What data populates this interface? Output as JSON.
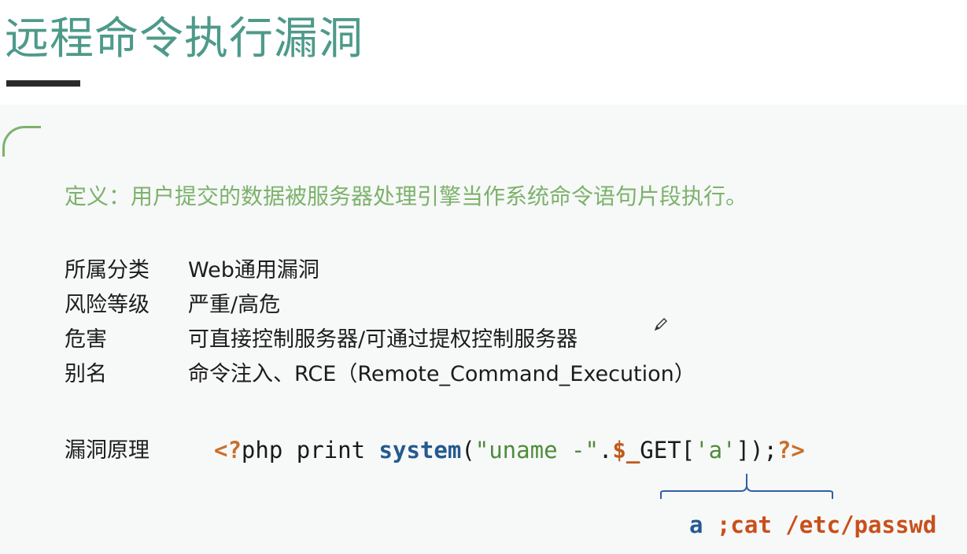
{
  "slide": {
    "title": "远程命令执行漏洞",
    "definition": "定义：用户提交的数据被服务器处理引擎当作系统命令语句片段执行。",
    "rows": [
      {
        "label": "所属分类",
        "value": "Web通用漏洞"
      },
      {
        "label": "风险等级",
        "value": "严重/高危"
      },
      {
        "label": "危害",
        "value": "可直接控制服务器/可通过提权控制服务器"
      },
      {
        "label": "别名",
        "value": "命令注入、RCE（Remote_Command_Execution）"
      }
    ],
    "principle_label": "漏洞原理",
    "code": {
      "open_tag": "<?",
      "php_print": "php print ",
      "fn": "system",
      "paren_open": "(",
      "str1": "\"uname -\"",
      "dot": ".",
      "var": "$_",
      "get": "GET[",
      "key": "'a'",
      "tail": "]);",
      "close_tag": "?>"
    },
    "payload": {
      "param": "a",
      "command": ";cat /etc/passwd"
    }
  },
  "colors": {
    "title": "#4e9a8a",
    "definition": "#7cb26c",
    "function": "#245a8f",
    "string": "#4e8c3c",
    "tag": "#c8702a"
  }
}
